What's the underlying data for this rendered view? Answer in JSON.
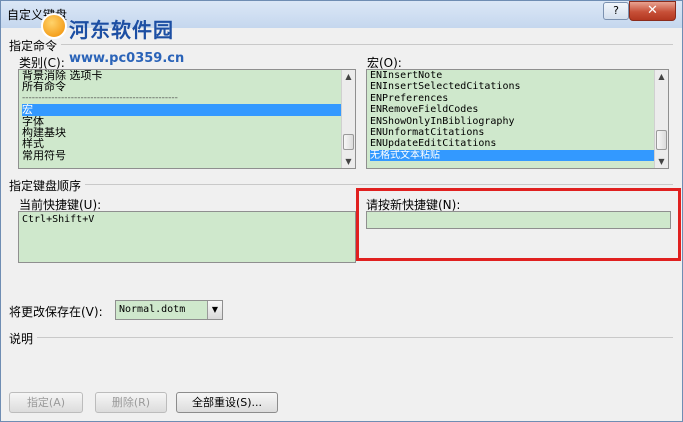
{
  "window": {
    "title": "自定义键盘"
  },
  "watermark": {
    "site": "河东软件园",
    "url": "www.pc0359.cn"
  },
  "titlebar": {
    "help": "?",
    "close": "✕"
  },
  "command_section": {
    "heading": "指定命令"
  },
  "categories": {
    "label": "类别(C):",
    "items": [
      {
        "text": "背景消除 选项卡",
        "selected": false
      },
      {
        "text": "所有命令",
        "selected": false
      },
      {
        "text": "------------------------------------------------",
        "selected": false,
        "divider": true
      },
      {
        "text": "宏",
        "selected": true
      },
      {
        "text": "字体",
        "selected": false
      },
      {
        "text": "构建基块",
        "selected": false
      },
      {
        "text": "样式",
        "selected": false
      },
      {
        "text": "常用符号",
        "selected": false
      }
    ]
  },
  "macros": {
    "label": "宏(O):",
    "items": [
      {
        "text": "ENInsertNote",
        "selected": false
      },
      {
        "text": "ENInsertSelectedCitations",
        "selected": false
      },
      {
        "text": "ENPreferences",
        "selected": false
      },
      {
        "text": "ENRemoveFieldCodes",
        "selected": false
      },
      {
        "text": "ENShowOnlyInBibliography",
        "selected": false
      },
      {
        "text": "ENUnformatCitations",
        "selected": false
      },
      {
        "text": "ENUpdateEditCitations",
        "selected": false
      },
      {
        "text": "无格式文本粘贴",
        "selected": true
      }
    ]
  },
  "key_sequence": {
    "heading": "指定键盘顺序",
    "current_label": "当前快捷键(U):",
    "current_value": "Ctrl+Shift+V",
    "new_label": "请按新快捷键(N):",
    "new_value": ""
  },
  "save_in": {
    "label": "将更改保存在(V):",
    "value": "Normal.dotm"
  },
  "description": {
    "label": "说明"
  },
  "buttons": {
    "assign": "指定(A)",
    "remove": "删除(R)",
    "reset_all": "全部重设(S)..."
  }
}
